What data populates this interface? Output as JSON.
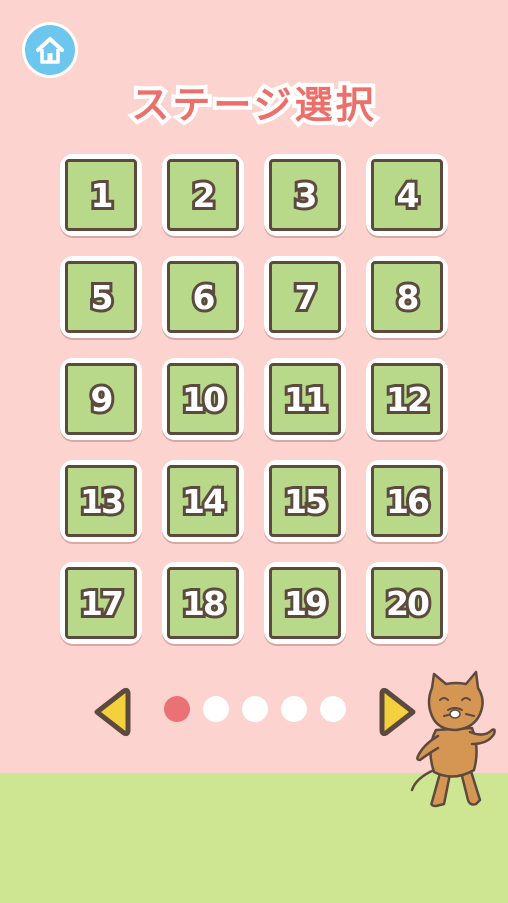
{
  "screen": {
    "title": "ステージ選択",
    "background_color": "#fcd3cf",
    "ground_color": "#cee592"
  },
  "home_button": {
    "icon": "home-icon",
    "color": "#6cc6ee"
  },
  "stages": [
    "1",
    "2",
    "3",
    "4",
    "5",
    "6",
    "7",
    "8",
    "9",
    "10",
    "11",
    "12",
    "13",
    "14",
    "15",
    "16",
    "17",
    "18",
    "19",
    "20"
  ],
  "stage_tile": {
    "fill_color": "#b9d98a",
    "border_color": "#5c4a3e"
  },
  "pagination": {
    "current_page": 1,
    "total_pages": 5,
    "active_color": "#ea7275"
  },
  "navigation": {
    "prev_icon": "triangle-left-icon",
    "next_icon": "triangle-right-icon",
    "arrow_color": "#f3d03c"
  },
  "mascot": {
    "icon": "cat-icon",
    "color": "#d69653"
  }
}
